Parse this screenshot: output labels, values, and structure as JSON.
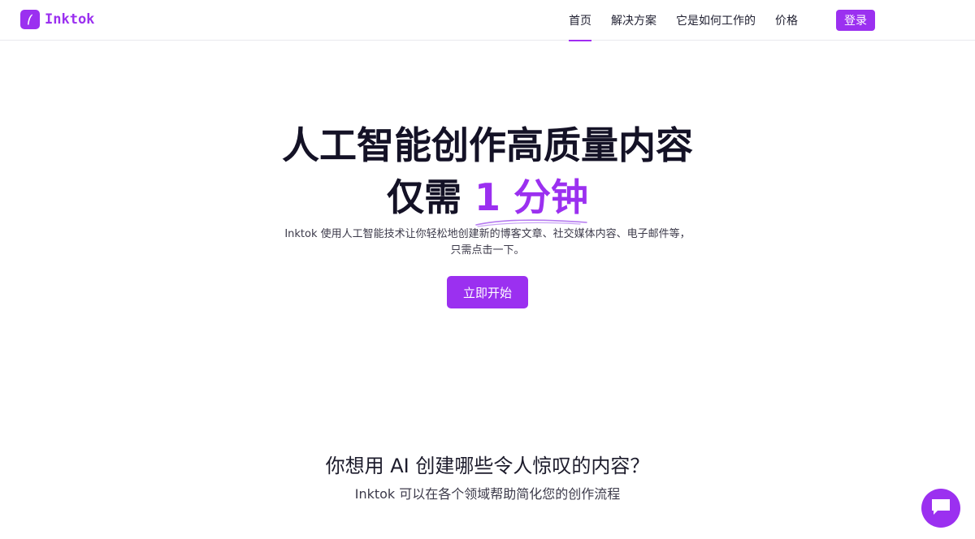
{
  "brand": {
    "name": "Inktok",
    "accent_color": "#9b30f0",
    "logo_icon": "feather-logo-icon"
  },
  "nav": {
    "items": [
      {
        "label": "首页",
        "active": true
      },
      {
        "label": "解决方案",
        "active": false
      },
      {
        "label": "它是如何工作的",
        "active": false
      },
      {
        "label": "价格",
        "active": false
      }
    ],
    "login_label": "登录"
  },
  "hero": {
    "title_line1": "人工智能创作高质量内容",
    "title_line2_prefix": "仅需",
    "title_line2_highlight": "1 分钟",
    "description": "Inktok 使用人工智能技术让你轻松地创建新的博客文章、社交媒体内容、电子邮件等，只需点击一下。",
    "cta_label": "立即开始"
  },
  "features": {
    "title": "你想用 AI 创建哪些令人惊叹的内容？",
    "subtitle": "Inktok 可以在各个领域帮助简化您的创作流程"
  },
  "chat": {
    "icon": "chat-bubble-icon"
  }
}
